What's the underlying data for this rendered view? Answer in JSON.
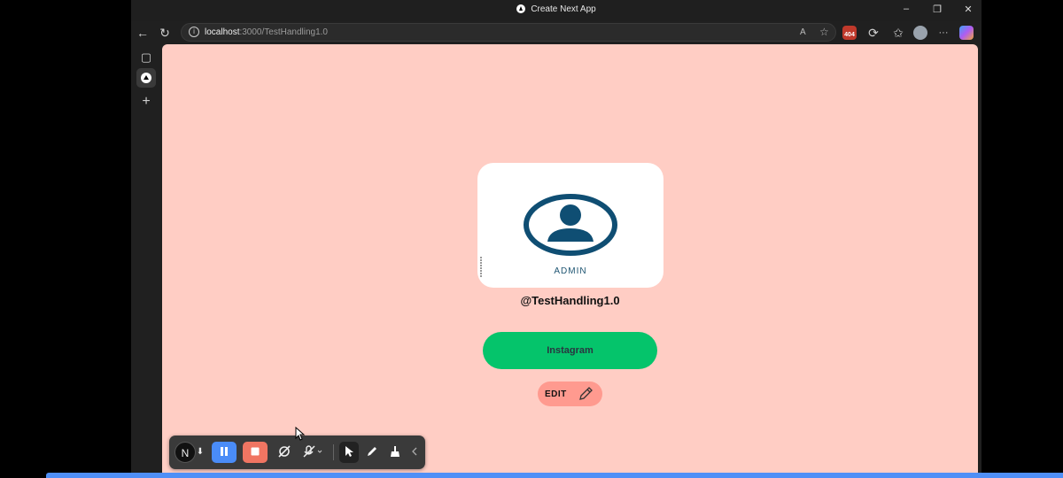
{
  "window": {
    "title": "Create Next App",
    "minimize": "–",
    "restore": "❐",
    "close": "✕"
  },
  "toolbar": {
    "back": "←",
    "reload": "↻",
    "url_host": "localhost",
    "url_path": ":3000/TestHandling1.0",
    "read_aloud": "A",
    "favorite": "☆",
    "ext_badge": "404",
    "refresh_ext": "⟳",
    "favorites": "✩",
    "more": "···"
  },
  "sidebar": {
    "tabs_icon": "▢",
    "new_tab": "+"
  },
  "profile": {
    "image_caption": "ADMIN",
    "handle": "@TestHandling1.0",
    "link_label": "Instagram",
    "edit_label": "EDIT"
  },
  "recorder": {
    "avatar_letter": "N",
    "arrow": "⬇"
  },
  "colors": {
    "page_background": "#ffcdc4",
    "link_button": "#05c46b",
    "edit_button": "#ff9a8f",
    "admin_icon": "#0f4e73",
    "pause": "#4a8cf7",
    "stop": "#f07562"
  },
  "icons": [
    "back-icon",
    "reload-icon",
    "info-icon",
    "read-aloud-icon",
    "star-icon",
    "extension-icon",
    "favorites-icon",
    "profile-icon",
    "more-icon",
    "copilot-icon",
    "pencil-icon",
    "user-icon",
    "pause-icon",
    "stop-icon",
    "camera-off-icon",
    "mic-off-icon",
    "pointer-icon",
    "pen-icon",
    "broom-icon",
    "chevron-left-icon"
  ]
}
